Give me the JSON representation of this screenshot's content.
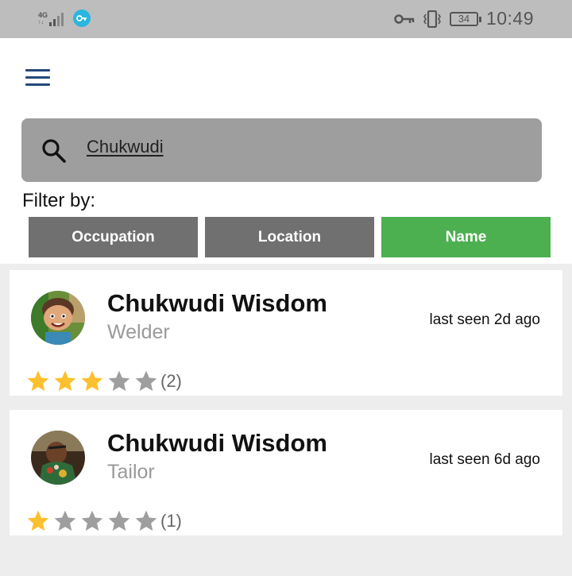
{
  "status_bar": {
    "network": "4G",
    "battery": "34",
    "time": "10:49",
    "icons": [
      "signal-icon",
      "vpn-icon",
      "key-icon",
      "vibrate-icon",
      "battery-icon"
    ]
  },
  "header": {
    "menu_icon": "hamburger-menu-icon"
  },
  "search": {
    "value": "Chukwudi",
    "icon": "search-icon"
  },
  "filter": {
    "label": "Filter by:",
    "tabs": [
      {
        "label": "Occupation",
        "active": false
      },
      {
        "label": "Location",
        "active": false
      },
      {
        "label": "Name",
        "active": true
      }
    ],
    "active_color": "#4caf50",
    "inactive_color": "#707070"
  },
  "results": [
    {
      "name": "Chukwudi Wisdom",
      "occupation": "Welder",
      "last_seen": "last seen 2d ago",
      "rating": 3,
      "max_rating": 5,
      "review_count": "(2)"
    },
    {
      "name": "Chukwudi Wisdom",
      "occupation": "Tailor",
      "last_seen": "last seen 6d ago",
      "rating": 1,
      "max_rating": 5,
      "review_count": "(1)"
    }
  ],
  "colors": {
    "star_filled": "#fbc02d",
    "star_empty": "#9e9e9e",
    "menu": "#24497a"
  }
}
